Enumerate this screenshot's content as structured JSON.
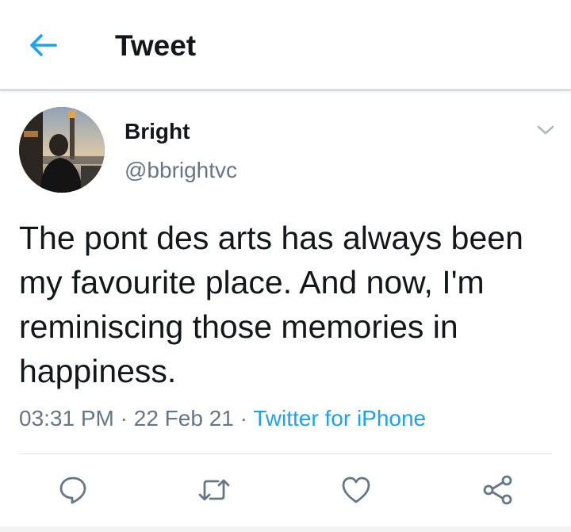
{
  "header": {
    "title": "Tweet",
    "back_icon": "arrow-left-icon",
    "accent": "#1da1f2"
  },
  "tweet": {
    "author": {
      "display_name": "Bright",
      "handle": "@bbrightvc"
    },
    "text": "The pont des arts has always been my favourite place. And now, I'm reminiscing those memories in happiness.",
    "time": "03:31 PM",
    "date": "22 Feb 21",
    "separator": "·",
    "source": "Twitter for iPhone"
  },
  "actions": [
    {
      "name": "reply",
      "icon": "speech-bubble-icon"
    },
    {
      "name": "retweet",
      "icon": "retweet-arrows-icon"
    },
    {
      "name": "like",
      "icon": "heart-icon"
    },
    {
      "name": "share",
      "icon": "share-nodes-icon"
    }
  ],
  "colors": {
    "text": "#14171a",
    "secondary": "#657786",
    "link": "#1da1f2",
    "divider": "#dce0e4"
  }
}
